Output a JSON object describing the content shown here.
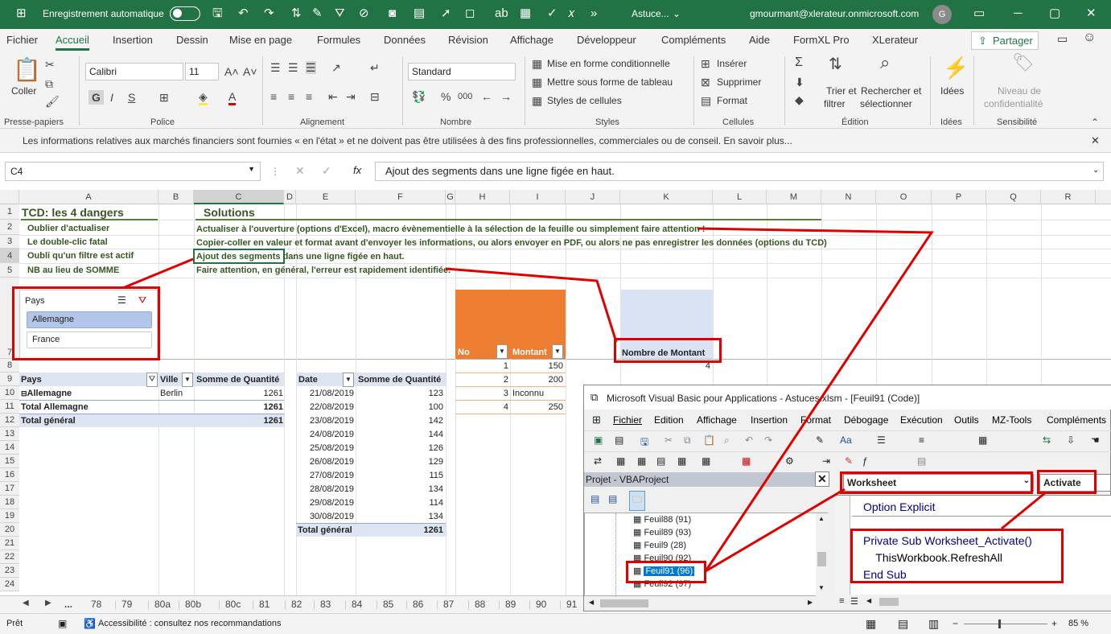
{
  "titlebar": {
    "autosave": "Enregistrement automatique",
    "doc": "Astuce...",
    "user": "gmourmant@xlerateur.onmicrosoft.com",
    "avatar": "G"
  },
  "menu": {
    "tabs": [
      "Fichier",
      "Accueil",
      "Insertion",
      "Dessin",
      "Mise en page",
      "Formules",
      "Données",
      "Révision",
      "Affichage",
      "Développeur",
      "Compléments",
      "Aide",
      "FormXL Pro",
      "XLerateur"
    ],
    "share": "Partager"
  },
  "ribbon": {
    "paste": "Coller",
    "font": "Calibri",
    "size": "11",
    "number_format": "Standard",
    "cond": "Mise en forme conditionnelle",
    "table": "Mettre sous forme de tableau",
    "styles": "Styles de cellules",
    "insert": "Insérer",
    "delete": "Supprimer",
    "format": "Format",
    "sort1": "Trier et",
    "sort2": "filtrer",
    "find1": "Rechercher et",
    "find2": "sélectionner",
    "ideas": "Idées",
    "sens1": "Niveau de",
    "sens2": "confidentialité",
    "groups": [
      "Presse-papiers",
      "Police",
      "Alignement",
      "Nombre",
      "Styles",
      "Cellules",
      "Édition",
      "Idées",
      "Sensibilité"
    ]
  },
  "infobar": "Les informations relatives aux marchés financiers sont fournies « en l'état » et ne doivent pas être utilisées à des fins professionnelles, commerciales ou de conseil. En savoir plus...",
  "formula": {
    "namebox": "C4",
    "content": "Ajout des segments dans une ligne figée en haut."
  },
  "columns": [
    "A",
    "B",
    "C",
    "D",
    "E",
    "F",
    "G",
    "H",
    "I",
    "J",
    "K",
    "L",
    "M",
    "N",
    "O",
    "P",
    "Q",
    "R"
  ],
  "rows": [
    "1",
    "2",
    "3",
    "4",
    "5",
    "7",
    "8",
    "9",
    "10",
    "11",
    "12",
    "13",
    "14",
    "15",
    "16",
    "17",
    "18",
    "19",
    "20",
    "21",
    "22",
    "23",
    "24"
  ],
  "sheet": {
    "a1": "TCD: les 4 dangers",
    "c1": "Solutions",
    "dangers": [
      "Oublier d'actualiser",
      "Le double-clic fatal",
      "Oubli qu'un filtre est actif",
      "NB au lieu de SOMME"
    ],
    "solutions": [
      "Actualiser à l'ouverture (options d'Excel), macro évènementielle à la sélection de la feuille ou simplement faire attention !",
      "Copier-coller en valeur et format avant d'envoyer les informations, ou alors envoyer en PDF, ou alors ne pas enregistrer les données (options du TCD)",
      "Ajout des segments dans une ligne figée en haut.",
      "Faire attention, en général, l'erreur est rapidement identifiée."
    ],
    "slicer": {
      "title": "Pays",
      "items": [
        "Allemagne",
        "France"
      ]
    },
    "pivot1": {
      "h1": "Pays",
      "h2": "Ville",
      "h3": "Somme de Quantité",
      "r1a": "Allemagne",
      "r1b": "Berlin",
      "r1c": "1261",
      "r2a": "Total Allemagne",
      "r2c": "1261",
      "r3a": "Total général",
      "r3c": "1261"
    },
    "pivot2": {
      "h1": "Date",
      "h2": "Somme de Quantité",
      "rows": [
        [
          "21/08/2019",
          "123"
        ],
        [
          "22/08/2019",
          "100"
        ],
        [
          "23/08/2019",
          "142"
        ],
        [
          "24/08/2019",
          "144"
        ],
        [
          "25/08/2019",
          "126"
        ],
        [
          "26/08/2019",
          "129"
        ],
        [
          "27/08/2019",
          "115"
        ],
        [
          "28/08/2019",
          "134"
        ],
        [
          "29/08/2019",
          "114"
        ],
        [
          "30/08/2019",
          "134"
        ]
      ],
      "total": "Total général",
      "total_val": "1261"
    },
    "table": {
      "h1": "No",
      "h2": "Montant",
      "rows": [
        [
          "1",
          "150"
        ],
        [
          "2",
          "200"
        ],
        [
          "3",
          "Inconnu"
        ],
        [
          "4",
          "250"
        ]
      ]
    },
    "nb": {
      "label": "Nombre de Montant",
      "value": "4"
    }
  },
  "sheettabs": [
    "...",
    "78",
    "79",
    "80a",
    "80b",
    "80c",
    "81",
    "82",
    "83",
    "84",
    "85",
    "86",
    "87",
    "88",
    "89",
    "90",
    "91"
  ],
  "status": {
    "ready": "Prêt",
    "access": "Accessibilité : consultez nos recommandations",
    "zoom": "85 %"
  },
  "vba": {
    "title": "Microsoft Visual Basic pour Applications - Astuces.xlsm - [Feuil91 (Code)]",
    "menu": [
      "Fichier",
      "Edition",
      "Affichage",
      "Insertion",
      "Format",
      "Débogage",
      "Exécution",
      "Outils",
      "MZ-Tools",
      "Compléments"
    ],
    "project_title": "Projet - VBAProject",
    "tree": [
      "Feuil88 (91)",
      "Feuil89 (93)",
      "Feuil9 (28)",
      "Feuil90 (92)",
      "Feuil91 (96)",
      "Feuil92 (97)"
    ],
    "object": "Worksheet",
    "proc": "Activate",
    "code": [
      "Option Explicit",
      "Private Sub Worksheet_Activate()",
      "    ThisWorkbook.RefreshAll",
      "End Sub"
    ]
  }
}
